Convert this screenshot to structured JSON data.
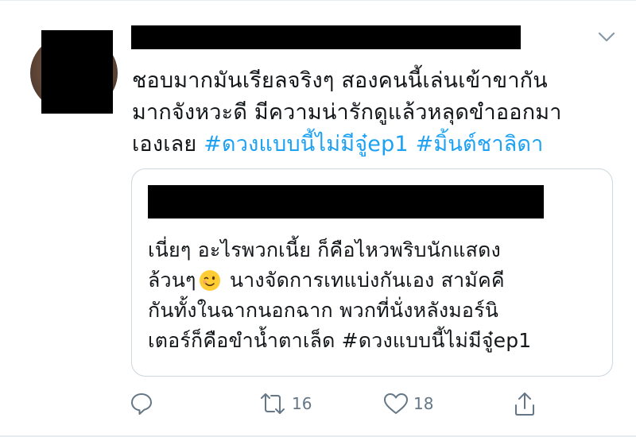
{
  "tweet": {
    "text_lines": [
      "ชอบมากมันเรียลจริงๆ สองคนนี้เล่นเข้าขากัน",
      "มากจังหวะดี มีความน่ารักดูแล้วหลุดขำออกมา",
      "เองเลย "
    ],
    "hashtags": [
      "#ดวงแบบนี้ไม่มีจู๋ep1",
      "#มิ้นต์ชาลิดา"
    ]
  },
  "quote": {
    "line1": "เนี่ยๆ อะไรพวกเนี้ย ก็คือไหวพริบนักแสดง",
    "line2_a": "ล้วนๆ",
    "line2_b": " นางจัดการเทแบ่งกันเอง สามัคคี",
    "line3": "กันทั้งในฉากนอกฉาก พวกที่นั่งหลังมอร์นิ",
    "line4": "เตอร์ก็คือขำน้ำตาเล็ด #ดวงแบบนี้ไม่มีจู๋ep1",
    "emoji": "winking-face-emoji"
  },
  "actions": {
    "retweets": "16",
    "likes": "18"
  },
  "icons": [
    "chevron-down-icon",
    "reply-icon",
    "retweet-icon",
    "like-icon",
    "share-icon"
  ],
  "colors": {
    "hashtag": "#1da1f2",
    "icon": "#657786",
    "border": "#ccd6dd"
  }
}
